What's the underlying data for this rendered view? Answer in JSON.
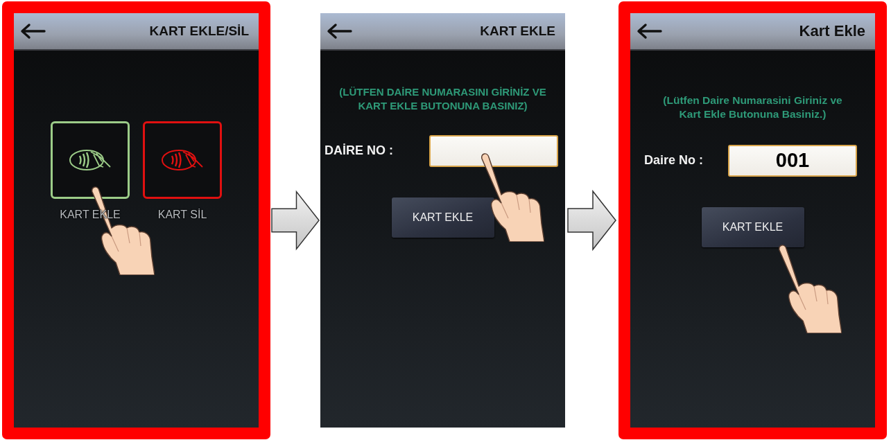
{
  "steps": [
    {
      "kind": "menu",
      "highlighted": true,
      "title": "KART EKLE/SİL",
      "options": [
        {
          "label": "KART EKLE",
          "color": "#9ccc88"
        },
        {
          "label": "KART SİL",
          "color": "#e01010"
        }
      ]
    },
    {
      "kind": "form",
      "highlighted": false,
      "title": "KART EKLE",
      "instruction": "(LÜTFEN DAİRE NUMARASINI GİRİNİZ VE KART EKLE BUTONUNA BASINIZ)",
      "field_label": "DAİRE NO :",
      "button": "KART EKLE"
    },
    {
      "kind": "form",
      "highlighted": true,
      "title": "Kart Ekle",
      "instruction": "(Lütfen Daire Numarasini Giriniz ve Kart Ekle Butonuna Basiniz.)",
      "field_label": "Daire No :",
      "field_value": "001",
      "button": "KART EKLE"
    }
  ]
}
